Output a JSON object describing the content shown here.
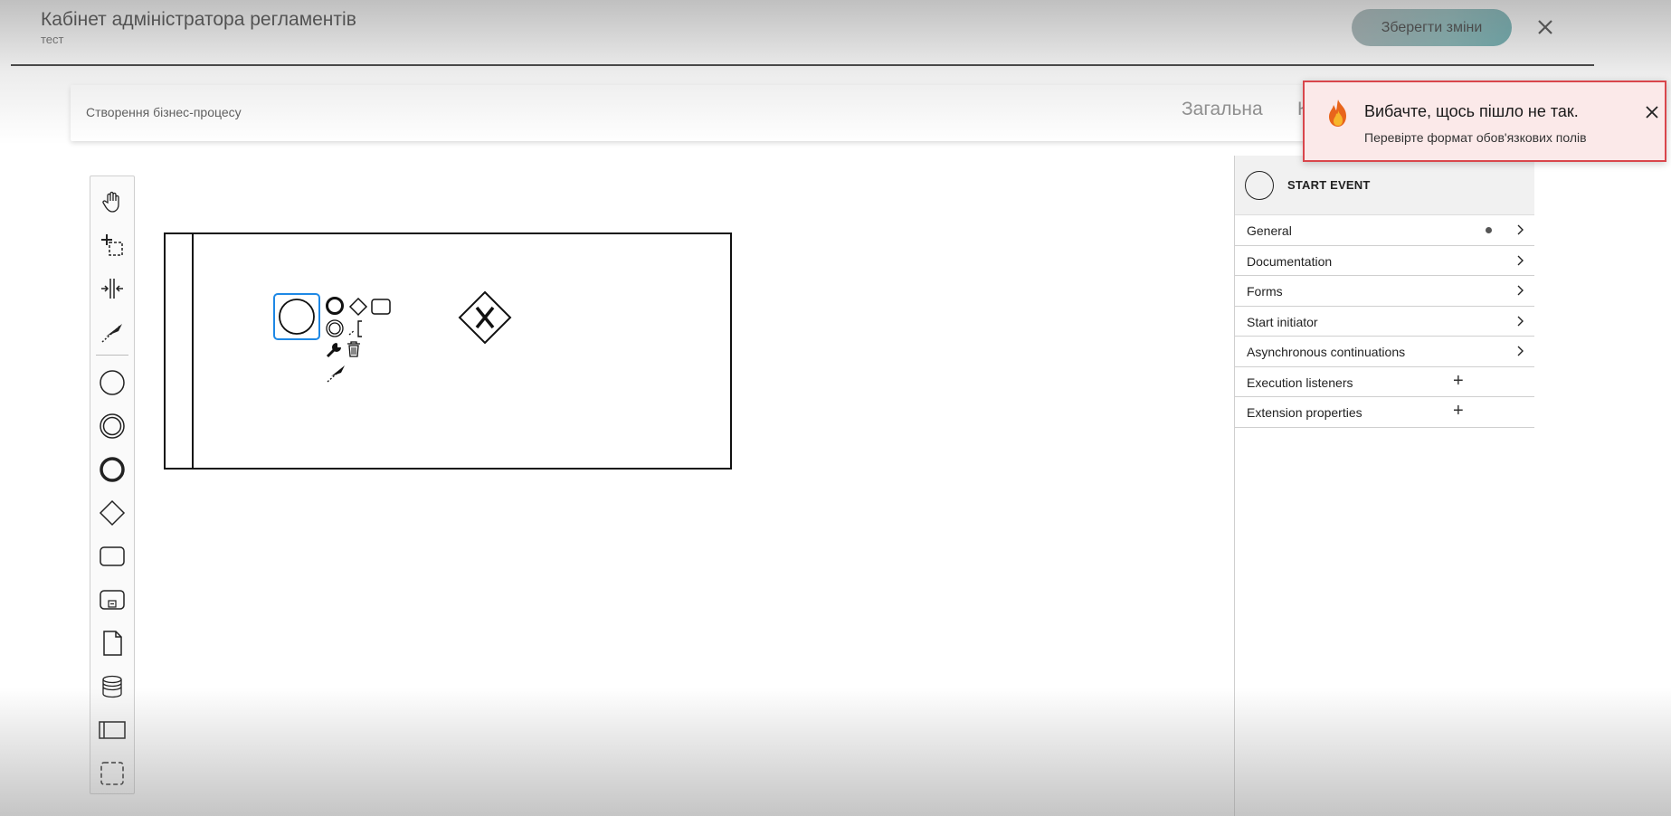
{
  "header": {
    "title": "Кабінет адміністратора регламентів",
    "subtitle": "тест",
    "save_label": "Зберегти зміни"
  },
  "subbar": {
    "label": "Створення бізнес-процесу",
    "tabs": [
      {
        "label": "Загальна"
      },
      {
        "label": "К"
      }
    ]
  },
  "palette": {
    "tools": [
      "hand-tool-icon",
      "lasso-tool-icon",
      "space-tool-icon",
      "global-connect-icon"
    ],
    "elements": [
      "start-event-icon",
      "intermediate-event-icon",
      "end-event-icon",
      "gateway-icon",
      "task-icon",
      "subprocess-icon",
      "data-object-icon",
      "data-store-icon",
      "participant-icon",
      "group-icon"
    ]
  },
  "properties": {
    "element_type": "START EVENT",
    "sections": [
      {
        "label": "General",
        "kind": "chevron",
        "has_dot": true
      },
      {
        "label": "Documentation",
        "kind": "chevron"
      },
      {
        "label": "Forms",
        "kind": "chevron"
      },
      {
        "label": "Start initiator",
        "kind": "chevron"
      },
      {
        "label": "Asynchronous continuations",
        "kind": "chevron"
      },
      {
        "label": "Execution listeners",
        "kind": "plus"
      },
      {
        "label": "Extension properties",
        "kind": "plus"
      }
    ],
    "plus_symbol": "+"
  },
  "toast": {
    "title": "Вибачте, щось пішло не так.",
    "message": "Перевірте формат обов'язкових полів",
    "border_color": "#d9464c",
    "background": "#fbe9e9"
  },
  "colors": {
    "selection": "#1e88e5",
    "save_button_accent": "#4f9fa2"
  }
}
